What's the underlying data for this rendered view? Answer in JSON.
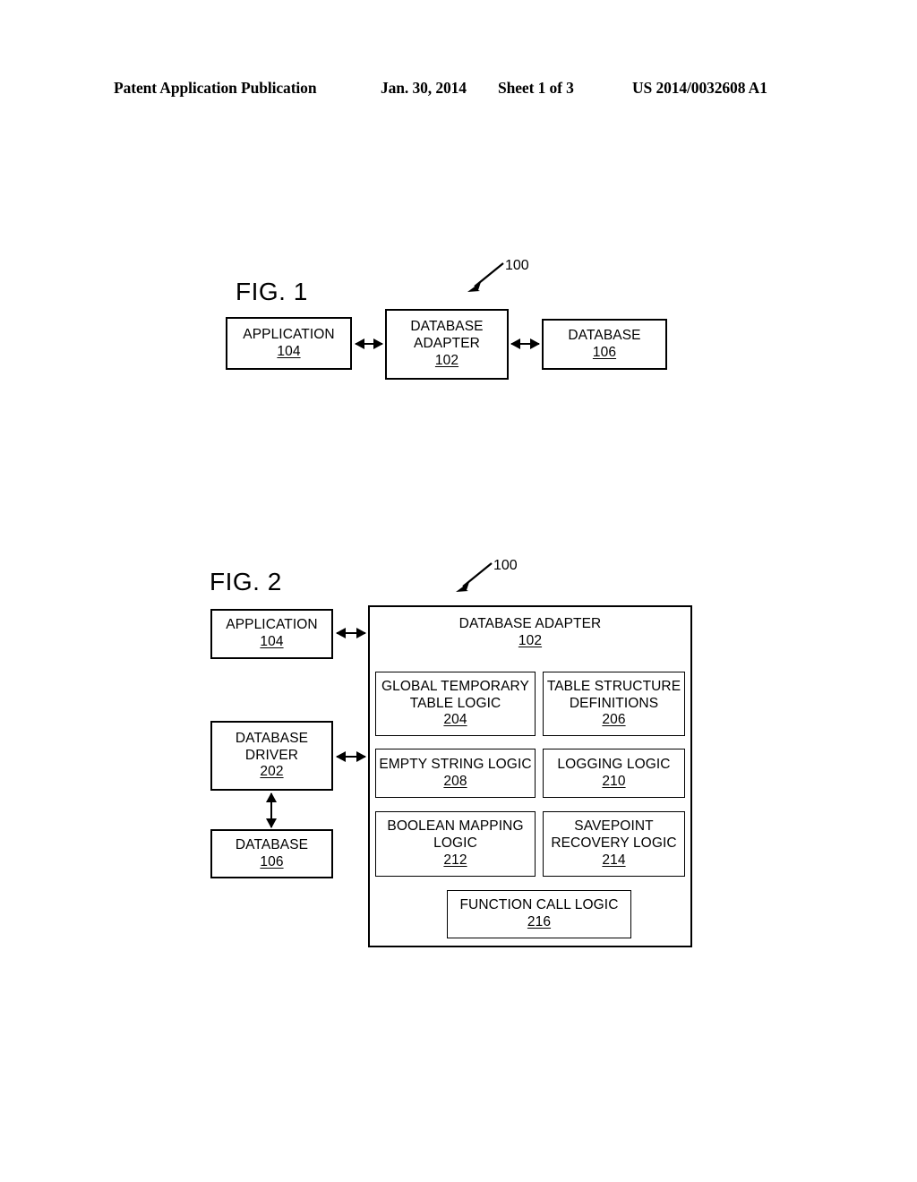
{
  "header": {
    "publication": "Patent Application Publication",
    "date": "Jan. 30, 2014",
    "sheet": "Sheet 1 of 3",
    "patent_number": "US 2014/0032608 A1"
  },
  "figures": [
    {
      "label": "FIG. 1",
      "lead_numeral": "100",
      "boxes": [
        {
          "name": "application",
          "title": "APPLICATION",
          "ref": "104"
        },
        {
          "name": "database-adapter",
          "title_line1": "DATABASE",
          "title_line2": "ADAPTER",
          "ref": "102"
        },
        {
          "name": "database",
          "title": "DATABASE",
          "ref": "106"
        }
      ]
    },
    {
      "label": "FIG. 2",
      "lead_numeral": "100",
      "left_column": [
        {
          "name": "application",
          "title": "APPLICATION",
          "ref": "104"
        },
        {
          "name": "database-driver",
          "title_line1": "DATABASE",
          "title_line2": "DRIVER",
          "ref": "202"
        },
        {
          "name": "database",
          "title": "DATABASE",
          "ref": "106"
        }
      ],
      "adapter": {
        "title": "DATABASE ADAPTER",
        "ref": "102",
        "modules": [
          {
            "name": "global-temporary-table-logic",
            "line1": "GLOBAL TEMPORARY",
            "line2": "TABLE LOGIC",
            "ref": "204"
          },
          {
            "name": "table-structure-definitions",
            "line1": "TABLE STRUCTURE",
            "line2": "DEFINITIONS",
            "ref": "206"
          },
          {
            "name": "empty-string-logic",
            "line1": "EMPTY STRING LOGIC",
            "line2": "",
            "ref": "208"
          },
          {
            "name": "logging-logic",
            "line1": "LOGGING LOGIC",
            "line2": "",
            "ref": "210"
          },
          {
            "name": "boolean-mapping-logic",
            "line1": "BOOLEAN MAPPING",
            "line2": "LOGIC",
            "ref": "212"
          },
          {
            "name": "savepoint-recovery-logic",
            "line1": "SAVEPOINT",
            "line2": "RECOVERY LOGIC",
            "ref": "214"
          },
          {
            "name": "function-call-logic",
            "line1": "FUNCTION CALL LOGIC",
            "line2": "",
            "ref": "216"
          }
        ]
      }
    }
  ]
}
